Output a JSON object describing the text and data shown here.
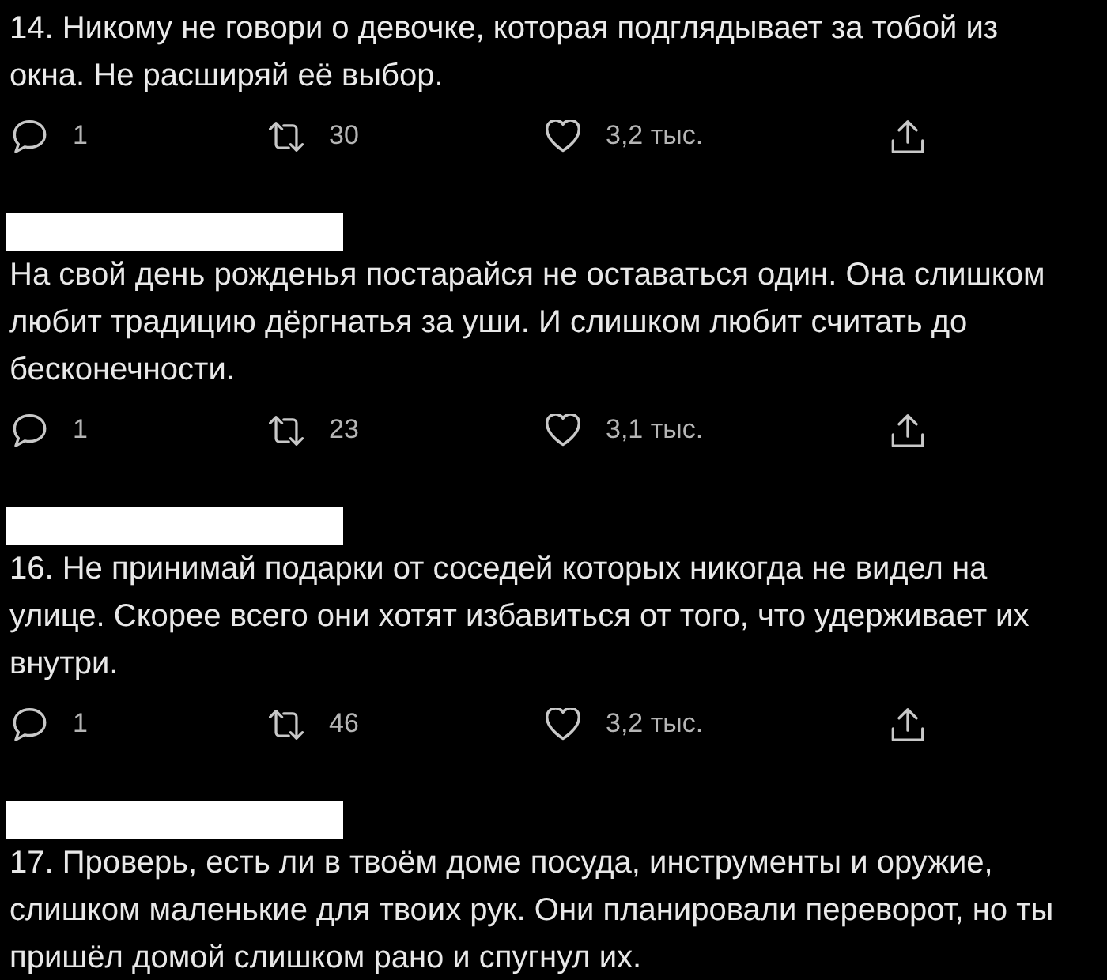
{
  "tweets": [
    {
      "author_redacted": false,
      "text": "14. Никому не говори о девочке, которая подглядывает за тобой из окна. Не расширяй её выбор.",
      "actions": [
        {
          "kind": "reply",
          "count": "1"
        },
        {
          "kind": "retweet",
          "count": "30"
        },
        {
          "kind": "like",
          "count": "3,2 тыс."
        },
        {
          "kind": "share"
        }
      ]
    },
    {
      "author_redacted": true,
      "text": "На свой день рожденья постарайся не оставаться один. Она слишком любит традицию дёргнатья за уши. И слишком любит считать до бесконечности.",
      "actions": [
        {
          "kind": "reply",
          "count": "1"
        },
        {
          "kind": "retweet",
          "count": "23"
        },
        {
          "kind": "like",
          "count": "3,1 тыс."
        },
        {
          "kind": "share"
        }
      ]
    },
    {
      "author_redacted": true,
      "text": "16. Не принимай подарки от соседей которых никогда не видел на улице. Скорее всего они хотят избавиться от того, что удерживает их внутри.",
      "actions": [
        {
          "kind": "reply",
          "count": "1"
        },
        {
          "kind": "retweet",
          "count": "46"
        },
        {
          "kind": "like",
          "count": "3,2 тыс."
        },
        {
          "kind": "share"
        }
      ]
    },
    {
      "author_redacted": true,
      "text": "17. Проверь, есть ли в твоём доме посуда, инструменты и оружие,\nслишком маленькие для твоих рук. Они планировали переворот, но ты пришёл домой слишком рано и спугнул их."
    }
  ]
}
